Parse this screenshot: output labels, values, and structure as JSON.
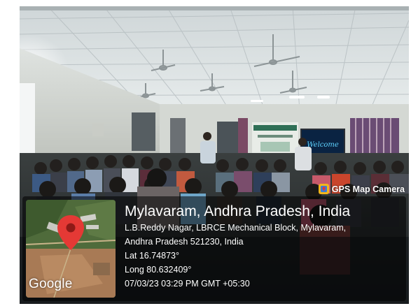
{
  "photo": {
    "description_visible": false
  },
  "gps_badge": {
    "label": "GPS Map Camera",
    "icon": "gps-map-camera-icon"
  },
  "map": {
    "logo_text": "Google",
    "pin_icon": "map-pin-icon"
  },
  "location": {
    "title": "Mylavaram, Andhra Pradesh, India",
    "address_line1": "L.B.Reddy Nagar, LBRCE Mechanical Block, Mylavaram,",
    "address_line2": "Andhra Pradesh 521230, India",
    "lat": "Lat 16.74873°",
    "long": "Long 80.632409°",
    "datetime": "07/03/23 03:29 PM GMT +05:30"
  },
  "screen_text": "Welcome",
  "colors": {
    "pin_red": "#e53935",
    "badge_yellow": "#f2b51c",
    "overlay": "rgba(0,0,0,0.55)"
  }
}
